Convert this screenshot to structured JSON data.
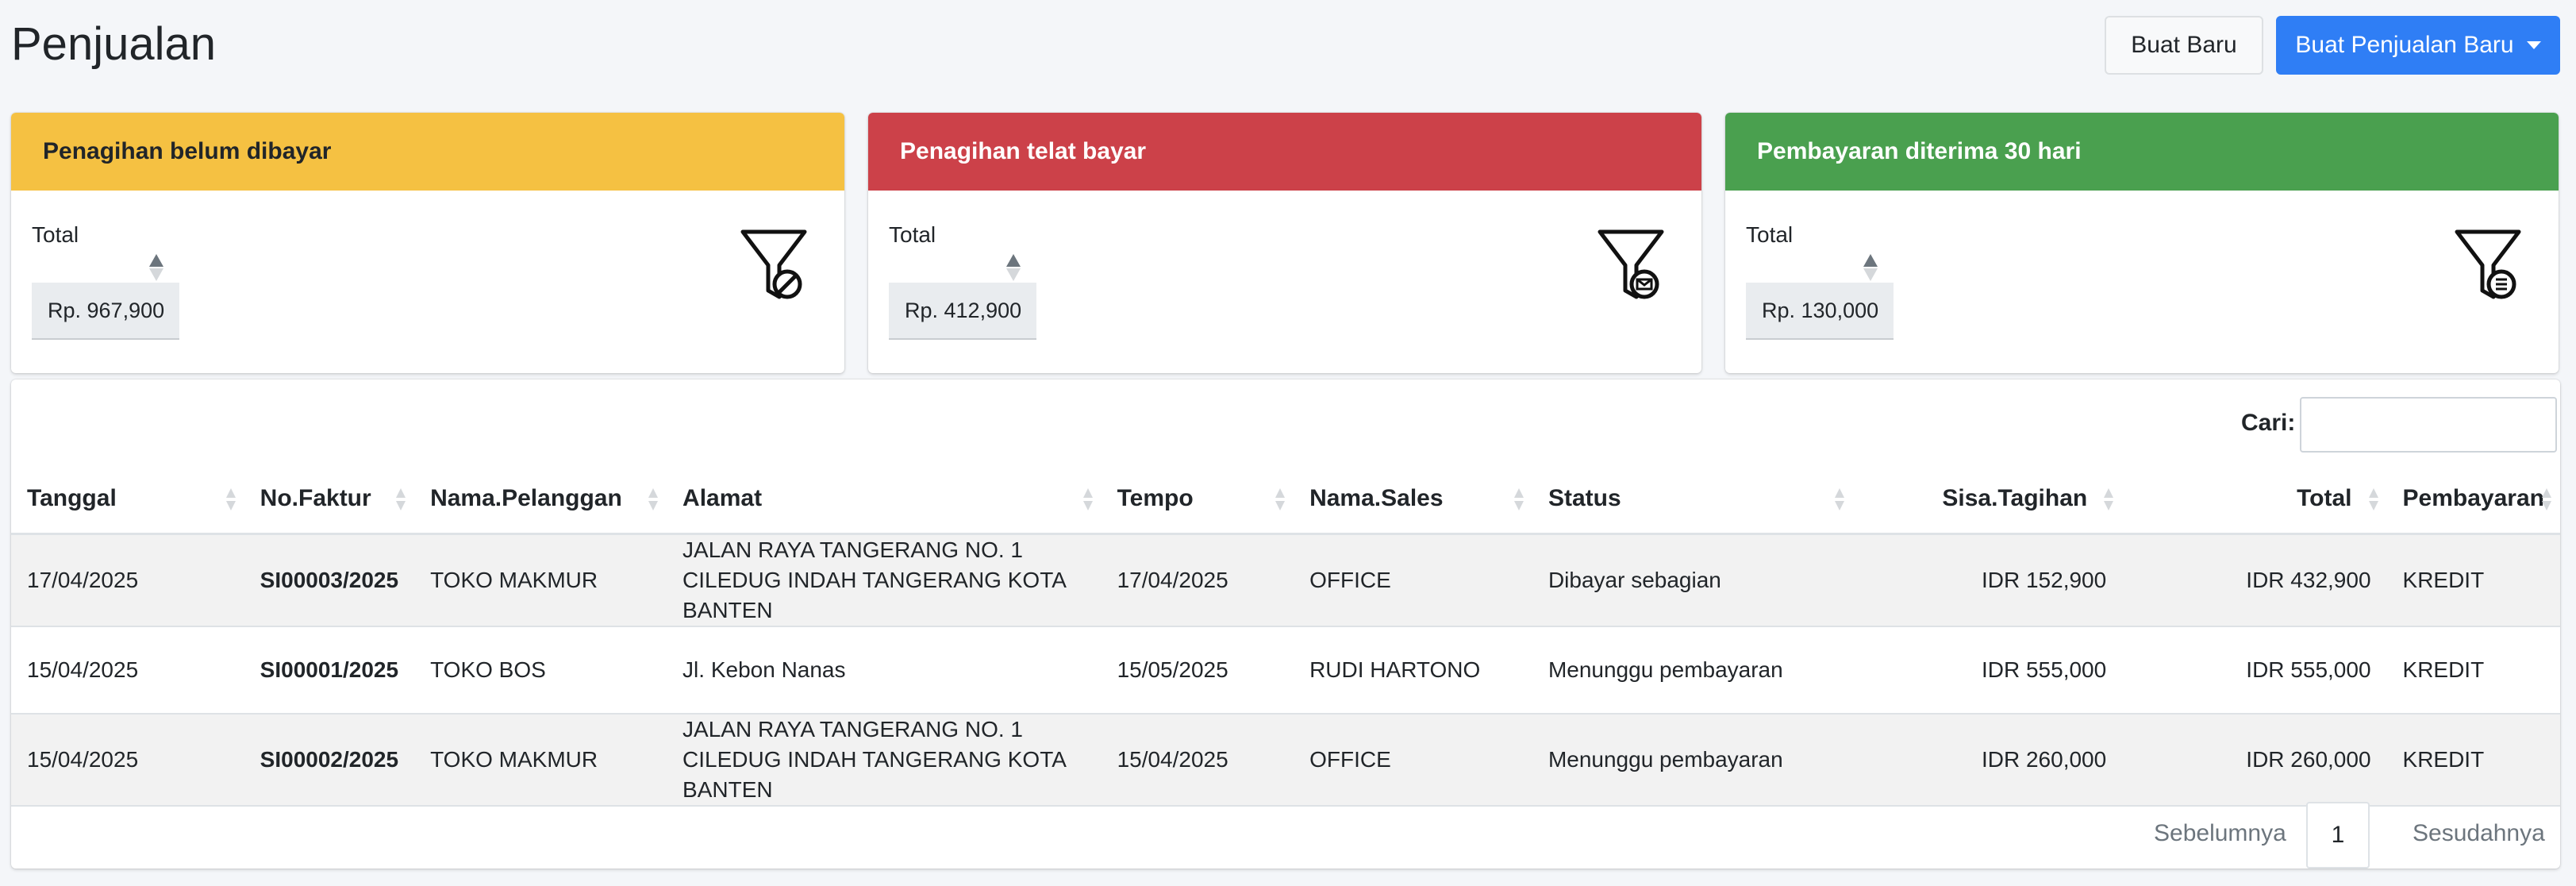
{
  "page": {
    "title": "Penjualan"
  },
  "toolbar": {
    "new_button": "Buat Baru",
    "new_sale_button": "Buat Penjualan Baru"
  },
  "cards": [
    {
      "title": "Penagihan belum dibayar",
      "total_label": "Total",
      "amount": "Rp. 967,900",
      "color": "#f5c142",
      "text_color": "#212529"
    },
    {
      "title": "Penagihan telat bayar",
      "total_label": "Total",
      "amount": "Rp. 412,900",
      "color": "#cc4149",
      "text_color": "#ffffff"
    },
    {
      "title": "Pembayaran diterima 30 hari",
      "total_label": "Total",
      "amount": "Rp. 130,000",
      "color": "#4aa04f",
      "text_color": "#ffffff"
    }
  ],
  "search": {
    "label": "Cari:",
    "value": ""
  },
  "table": {
    "headers": [
      "Tanggal",
      "No.Faktur",
      "Nama.Pelanggan",
      "Alamat",
      "Tempo",
      "Nama.Sales",
      "Status",
      "Sisa.Tagihan",
      "Total",
      "Pembayaran"
    ],
    "rows": [
      [
        "17/04/2025",
        "SI00003/2025",
        "TOKO MAKMUR",
        "JALAN RAYA TANGERANG NO. 1 CILEDUG INDAH TANGERANG KOTA BANTEN",
        "17/04/2025",
        "OFFICE",
        "Dibayar sebagian",
        "IDR 152,900",
        "IDR 432,900",
        "KREDIT"
      ],
      [
        "15/04/2025",
        "SI00001/2025",
        "TOKO BOS",
        "Jl. Kebon Nanas",
        "15/05/2025",
        "RUDI HARTONO",
        "Menunggu pembayaran",
        "IDR 555,000",
        "IDR 555,000",
        "KREDIT"
      ],
      [
        "15/04/2025",
        "SI00002/2025",
        "TOKO MAKMUR",
        "JALAN RAYA TANGERANG NO. 1 CILEDUG INDAH TANGERANG KOTA BANTEN",
        "15/04/2025",
        "OFFICE",
        "Menunggu pembayaran",
        "IDR 260,000",
        "IDR 260,000",
        "KREDIT"
      ]
    ]
  },
  "pagination": {
    "prev": "Sebelumnya",
    "current": "1",
    "next": "Sesudahnya"
  }
}
